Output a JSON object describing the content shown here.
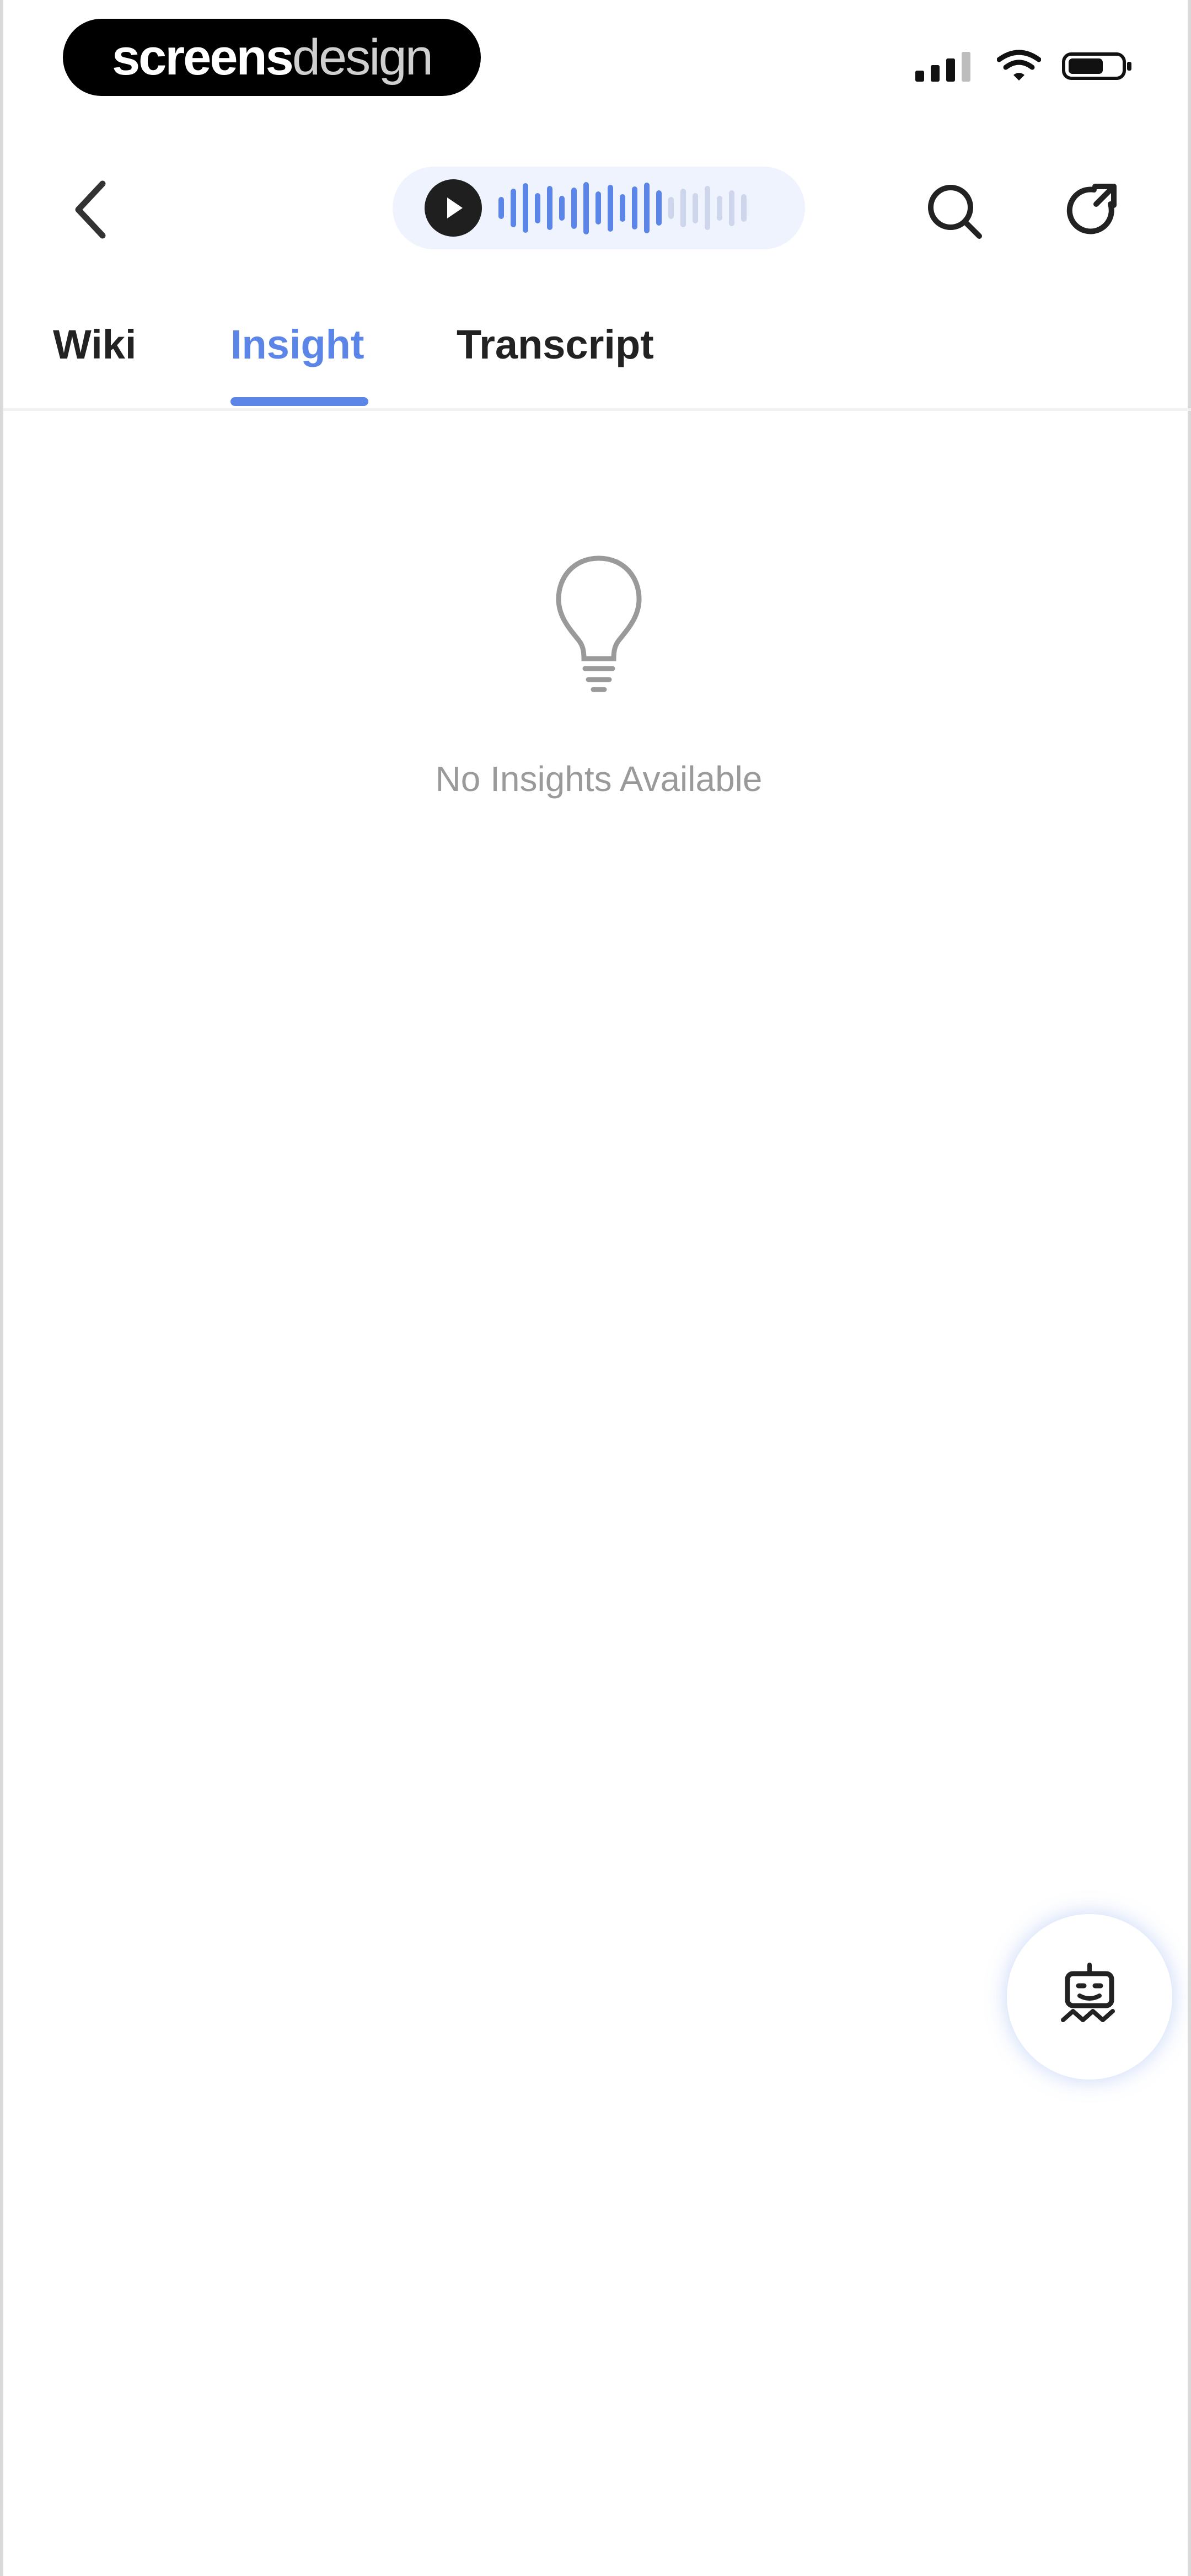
{
  "status_bar": {
    "logo_bold": "screens",
    "logo_light": "design"
  },
  "tabs": [
    {
      "label": "Wiki"
    },
    {
      "label": "Insight"
    },
    {
      "label": "Transcript"
    }
  ],
  "active_tab": "Insight",
  "empty_state": {
    "message": "No Insights Available",
    "icon": "lightbulb-icon"
  },
  "colors": {
    "accent": "#5b86e8",
    "pill_bg": "#eef3fd",
    "text_dark": "#222222",
    "text_muted": "#9a9a9a"
  },
  "icons": {
    "back": "chevron-left-icon",
    "play": "play-icon",
    "search": "search-icon",
    "refresh": "refresh-icon",
    "fab": "assistant-bot-icon"
  }
}
